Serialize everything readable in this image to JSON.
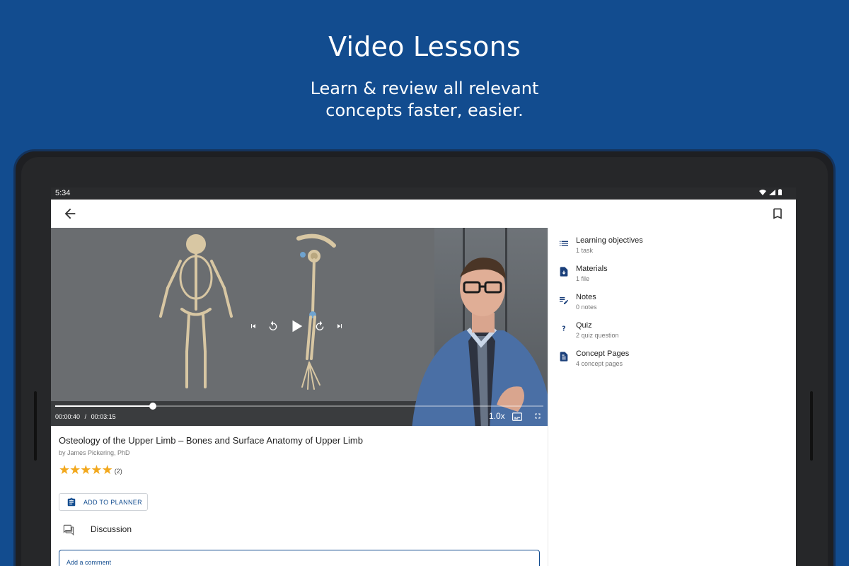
{
  "promo": {
    "headline": "Video Lessons",
    "subline_1": "Learn & review all relevant",
    "subline_2": "concepts faster, easier."
  },
  "status_bar": {
    "time": "5:34"
  },
  "video": {
    "elapsed": "00:00:40",
    "separator": "/",
    "duration": "00:03:15",
    "progress_fraction": 0.2,
    "speed": "1.0x"
  },
  "lesson": {
    "title": "Osteology of the Upper Limb – Bones and Surface Anatomy of Upper Limb",
    "author": "by James Pickering, PhD",
    "rating_stars": 5,
    "rating_count": "(2)",
    "planner_label": "ADD TO PLANNER",
    "discussion_label": "Discussion",
    "comment_placeholder": "Add a comment"
  },
  "side_panel": {
    "items": [
      {
        "title": "Learning objectives",
        "sub": "1 task",
        "icon": "list-icon"
      },
      {
        "title": "Materials",
        "sub": "1 file",
        "icon": "download-file-icon"
      },
      {
        "title": "Notes",
        "sub": "0 notes",
        "icon": "edit-notes-icon"
      },
      {
        "title": "Quiz",
        "sub": "2 quiz question",
        "icon": "question-icon"
      },
      {
        "title": "Concept Pages",
        "sub": "4 concept pages",
        "icon": "document-icon"
      }
    ]
  },
  "colors": {
    "brand_blue": "#124c8f",
    "star": "#f2a81d",
    "icon_blue": "#1a3f7a"
  }
}
